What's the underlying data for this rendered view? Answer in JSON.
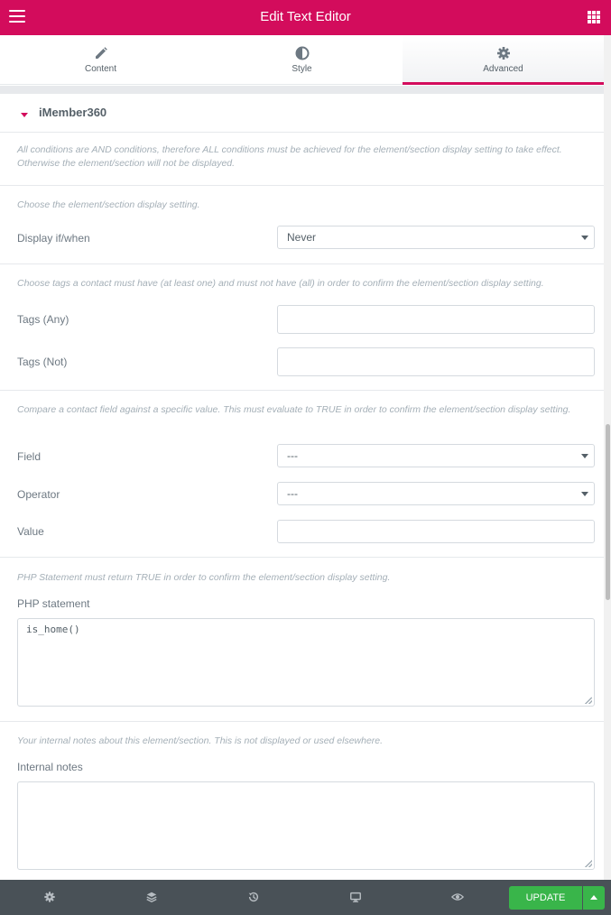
{
  "header": {
    "title": "Edit Text Editor",
    "menu_icon": "hamburger-icon",
    "apps_icon": "grid-icon",
    "color": "#d30c5c"
  },
  "tabs": [
    {
      "label": "Content",
      "icon": "pencil-icon"
    },
    {
      "label": "Style",
      "icon": "half-circle-icon"
    },
    {
      "label": "Advanced",
      "icon": "gear-icon",
      "active": true
    }
  ],
  "section": {
    "title": "iMember360",
    "intro": "All conditions are AND conditions, therefore ALL conditions must be achieved for the element/section display setting to take effect. Otherwise the element/section will not be displayed.",
    "display": {
      "description": "Choose the element/section display setting.",
      "label": "Display if/when",
      "value": "Never"
    },
    "tags": {
      "description": "Choose tags a contact must have (at least one) and must not have (all) in order to confirm the element/section display setting.",
      "any_label": "Tags (Any)",
      "not_label": "Tags (Not)",
      "any_value": "",
      "not_value": ""
    },
    "field_compare": {
      "description": "Compare a contact field against a specific value. This must evaluate to TRUE in order to confirm the element/section display setting.",
      "field_label": "Field",
      "field_value": "---",
      "operator_label": "Operator",
      "operator_value": "---",
      "value_label": "Value",
      "value_value": ""
    },
    "php": {
      "description": "PHP Statement must return TRUE in order to confirm the element/section display setting.",
      "label": "PHP statement",
      "value": "is_home()"
    },
    "notes": {
      "description": "Your internal notes about this element/section. This is not displayed or used elsewhere.",
      "label": "Internal notes",
      "value": ""
    }
  },
  "footer": {
    "icons": [
      "settings-icon",
      "layers-icon",
      "history-icon",
      "responsive-icon",
      "preview-icon"
    ],
    "update_label": "UPDATE",
    "update_color": "#39b54a"
  }
}
